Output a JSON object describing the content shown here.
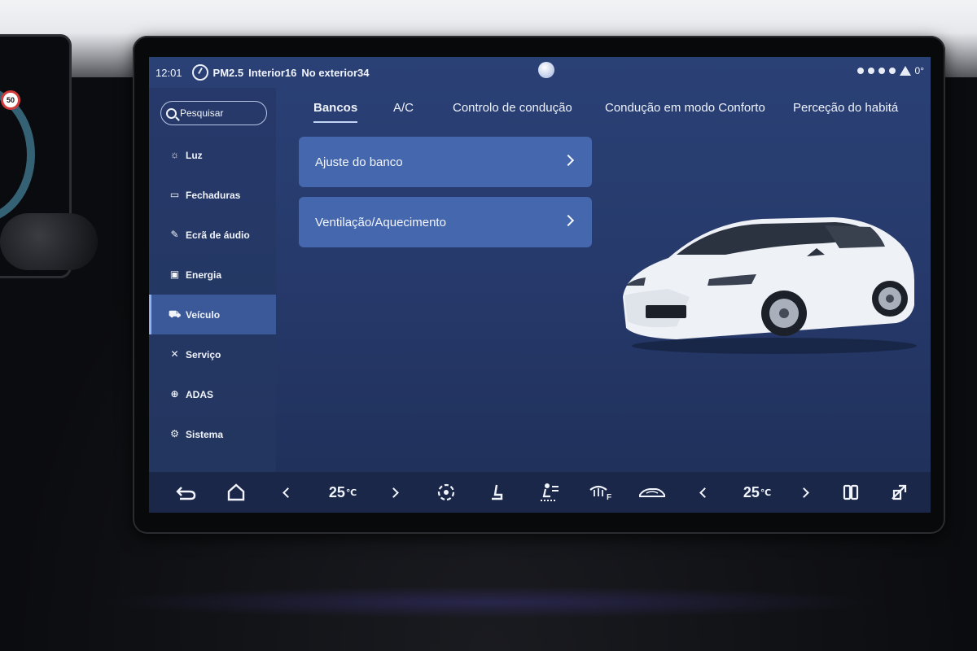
{
  "status_bar": {
    "time": "12:01",
    "pm_label": "PM2.5",
    "interior": "Interior16",
    "exterior": "No exterior34",
    "right_suffix": "0°"
  },
  "sidebar": {
    "search_placeholder": "Pesquisar",
    "items": [
      {
        "label": "Luz",
        "icon": "sun-icon",
        "active": false
      },
      {
        "label": "Fechaduras",
        "icon": "lock-icon",
        "active": false
      },
      {
        "label": "Ecrã de áudio",
        "icon": "screen-edit-icon",
        "active": false
      },
      {
        "label": "Energia",
        "icon": "battery-icon",
        "active": false
      },
      {
        "label": "Veículo",
        "icon": "car-icon",
        "active": true
      },
      {
        "label": "Serviço",
        "icon": "wrench-icon",
        "active": false
      },
      {
        "label": "ADAS",
        "icon": "steering-wheel-icon",
        "active": false
      },
      {
        "label": "Sistema",
        "icon": "gear-icon",
        "active": false
      }
    ]
  },
  "tabs": [
    {
      "label": "Bancos",
      "active": true
    },
    {
      "label": "A/C",
      "active": false
    },
    {
      "label": "Controlo de condução",
      "active": false
    },
    {
      "label": "Condução em modo Conforto",
      "active": false
    },
    {
      "label": "Perceção do habitá",
      "active": false
    }
  ],
  "cards": [
    {
      "label": "Ajuste do banco"
    },
    {
      "label": "Ventilação/Aquecimento"
    }
  ],
  "dock": {
    "left_temp": "25",
    "right_temp": "25",
    "temp_unit": "℃",
    "icons": [
      "back-icon",
      "home-icon",
      "fan-icon",
      "seat-icon",
      "air-direction-icon",
      "front-defrost-icon",
      "car-recirculation-icon",
      "rear-defrost-icon",
      "climate-off-icon"
    ]
  },
  "colors": {
    "screen_bg": "#26396a",
    "active_nav": "#3b5899",
    "card_bg": "#4467ae",
    "dock_bg": "#1a2749"
  }
}
